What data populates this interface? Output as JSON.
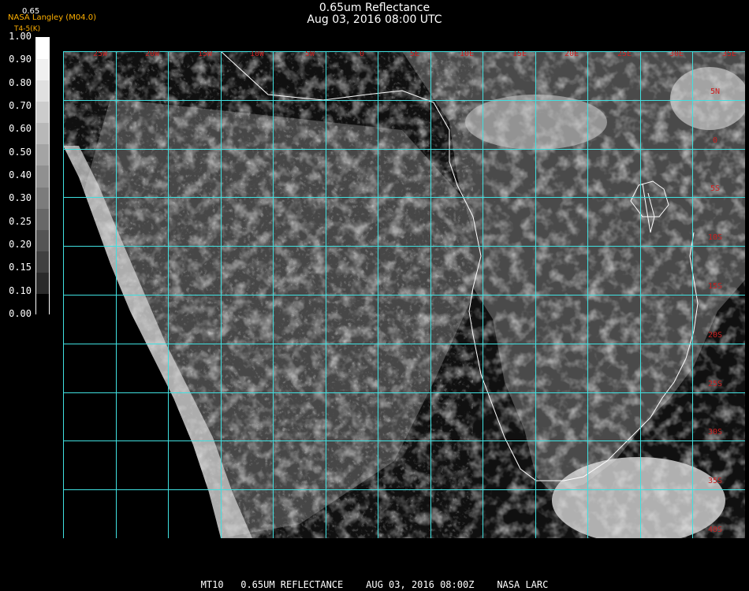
{
  "header": {
    "title": "0.65um Reflectance",
    "datetime": "Aug 03, 2016 08:00 UTC",
    "credit": "NASA Langley (M04.0)",
    "credit_sub": "T4-5(K)",
    "legend_label": "0.65"
  },
  "colorbar": {
    "labels": [
      "1.00",
      "0.90",
      "0.80",
      "0.70",
      "0.60",
      "0.50",
      "0.40",
      "0.30",
      "0.25",
      "0.20",
      "0.15",
      "0.10",
      "0.00"
    ],
    "shades": [
      "#ffffff",
      "#f0f0f0",
      "#e0e0e0",
      "#cccccc",
      "#b8b8b8",
      "#a4a4a4",
      "#909090",
      "#7c7c7c",
      "#686868",
      "#545454",
      "#404040",
      "#2a2a2a",
      "#000000"
    ]
  },
  "map": {
    "grid_color": "#40e0e0",
    "label_color": "#cc2020",
    "lon_labels": [
      "25W",
      "20W",
      "15W",
      "10W",
      "5W",
      "0",
      "5E",
      "10E",
      "15E",
      "20E",
      "25E",
      "30E",
      "35E"
    ],
    "lat_labels": [
      "5N",
      "0",
      "5S",
      "10S",
      "15S",
      "20S",
      "25S",
      "30S",
      "35S",
      "40S"
    ]
  },
  "footer": {
    "text": "MT10   0.65UM REFLECTANCE    AUG 03, 2016 08:00Z    NASA LARC"
  }
}
